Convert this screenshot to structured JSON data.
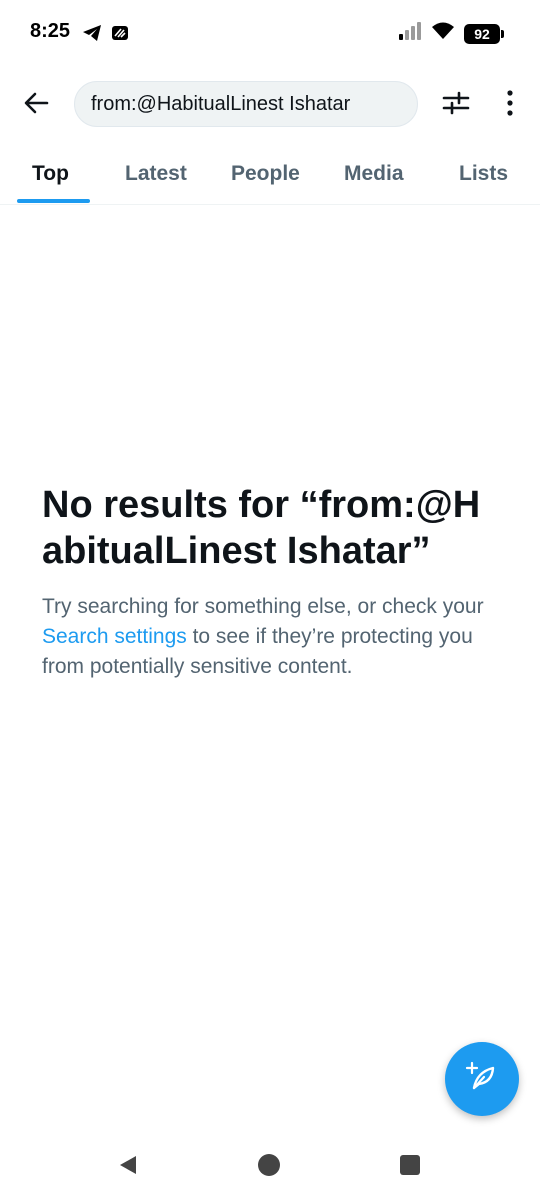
{
  "status_bar": {
    "time": "8:25",
    "battery": "92",
    "icons": [
      "telegram-icon",
      "app-notification-icon",
      "signal-icon",
      "wifi-icon",
      "battery-icon"
    ]
  },
  "header": {
    "search_query": "from:@HabitualLinest Ishatar",
    "icons": [
      "back-arrow-icon",
      "filter-sliders-icon",
      "more-vertical-icon"
    ]
  },
  "tabs": [
    {
      "label": "Top",
      "active": true
    },
    {
      "label": "Latest",
      "active": false
    },
    {
      "label": "People",
      "active": false
    },
    {
      "label": "Media",
      "active": false
    },
    {
      "label": "Lists",
      "active": false
    }
  ],
  "empty_state": {
    "title": "No results for “from:@HabitualLinest Ishatar”",
    "desc_before": "Try searching for something else, or check your ",
    "link": "Search settings",
    "desc_after": " to see if they’re protecting you from potentially sensitive content."
  },
  "fab": {
    "icon": "compose-feather-icon"
  },
  "nav_bar": {
    "icons": [
      "nav-back-icon",
      "nav-home-icon",
      "nav-recents-icon"
    ]
  },
  "colors": {
    "accent": "#1d9bf0",
    "text_primary": "#0f1419",
    "text_secondary": "#536471",
    "search_bg": "#eff3f4"
  }
}
